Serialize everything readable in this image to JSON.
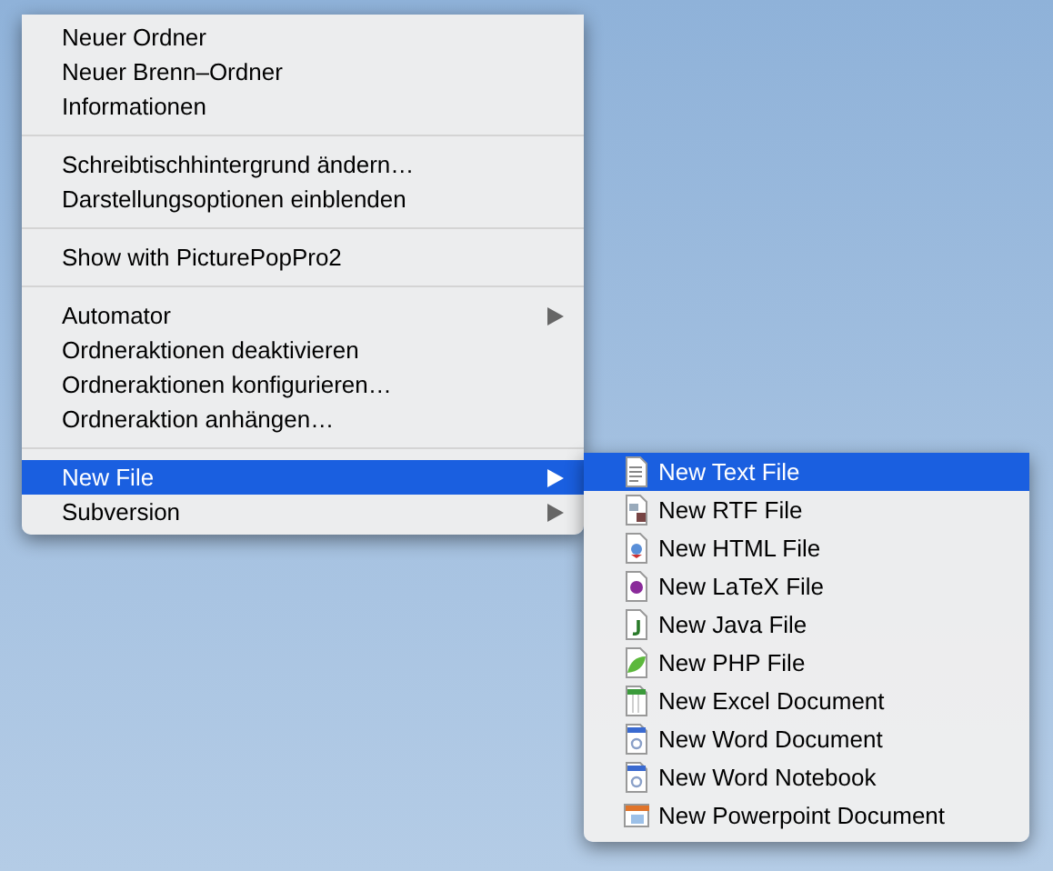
{
  "context_menu": {
    "groups": [
      [
        {
          "label": "Neuer Ordner",
          "selected": false,
          "has_submenu": false
        },
        {
          "label": "Neuer Brenn–Ordner",
          "selected": false,
          "has_submenu": false
        },
        {
          "label": "Informationen",
          "selected": false,
          "has_submenu": false
        }
      ],
      [
        {
          "label": "Schreibtischhintergrund ändern…",
          "selected": false,
          "has_submenu": false
        },
        {
          "label": "Darstellungsoptionen einblenden",
          "selected": false,
          "has_submenu": false
        }
      ],
      [
        {
          "label": "Show with PicturePopPro2",
          "selected": false,
          "has_submenu": false
        }
      ],
      [
        {
          "label": "Automator",
          "selected": false,
          "has_submenu": true
        },
        {
          "label": "Ordneraktionen deaktivieren",
          "selected": false,
          "has_submenu": false
        },
        {
          "label": "Ordneraktionen konfigurieren…",
          "selected": false,
          "has_submenu": false
        },
        {
          "label": "Ordneraktion anhängen…",
          "selected": false,
          "has_submenu": false
        }
      ],
      [
        {
          "label": "New File",
          "selected": true,
          "has_submenu": true
        },
        {
          "label": "Subversion",
          "selected": false,
          "has_submenu": true
        }
      ]
    ]
  },
  "submenu": {
    "items": [
      {
        "label": "New Text File",
        "selected": true,
        "kind": "text"
      },
      {
        "label": "New RTF File",
        "selected": false,
        "kind": "rtf"
      },
      {
        "label": "New HTML File",
        "selected": false,
        "kind": "html"
      },
      {
        "label": "New LaTeX File",
        "selected": false,
        "kind": "latex"
      },
      {
        "label": "New Java File",
        "selected": false,
        "kind": "java"
      },
      {
        "label": "New PHP File",
        "selected": false,
        "kind": "php"
      },
      {
        "label": "New Excel Document",
        "selected": false,
        "kind": "excel"
      },
      {
        "label": "New Word Document",
        "selected": false,
        "kind": "word"
      },
      {
        "label": "New Word Notebook",
        "selected": false,
        "kind": "word"
      },
      {
        "label": "New Powerpoint Document",
        "selected": false,
        "kind": "powerpoint"
      }
    ]
  }
}
